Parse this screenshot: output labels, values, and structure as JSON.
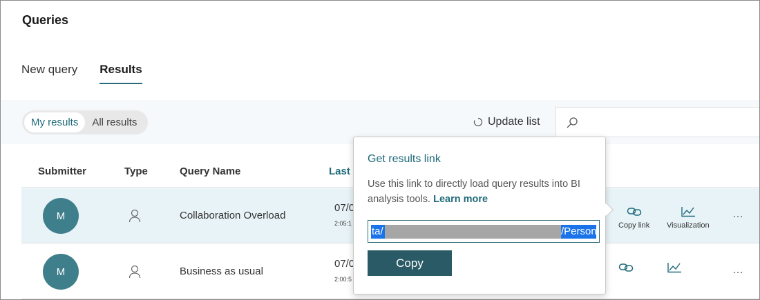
{
  "page": {
    "title": "Queries"
  },
  "tabs": [
    {
      "label": "New query",
      "active": false
    },
    {
      "label": "Results",
      "active": true
    }
  ],
  "filters": {
    "my_results": "My results",
    "all_results": "All results",
    "update_list": "Update list",
    "search_placeholder": ""
  },
  "columns": {
    "submitter": "Submitter",
    "type": "Type",
    "query_name": "Query Name",
    "last_run": "Last u"
  },
  "rows": [
    {
      "avatar": "M",
      "type_icon": "person-icon",
      "name": "Collaboration Overload",
      "date": "07/0",
      "time": "2:05:1"
    },
    {
      "avatar": "M",
      "type_icon": "person-icon",
      "name": "Business as usual",
      "date": "07/0",
      "time": "2:00:5"
    }
  ],
  "actions": {
    "copy_link": "Copy link",
    "visualization": "Visualization",
    "more": "…"
  },
  "popover": {
    "title": "Get results link",
    "description": "Use this link to directly load query results into BI analysis tools.",
    "learn_more": "Learn more",
    "url_start": "ta/",
    "url_end": "/Person",
    "copy_button": "Copy"
  },
  "colors": {
    "accent": "#1f6a7a",
    "avatar": "#3f7f8c",
    "selected_row": "#e8f3f7",
    "copy_button": "#2a5a66",
    "text_selection": "#1a73e8"
  }
}
